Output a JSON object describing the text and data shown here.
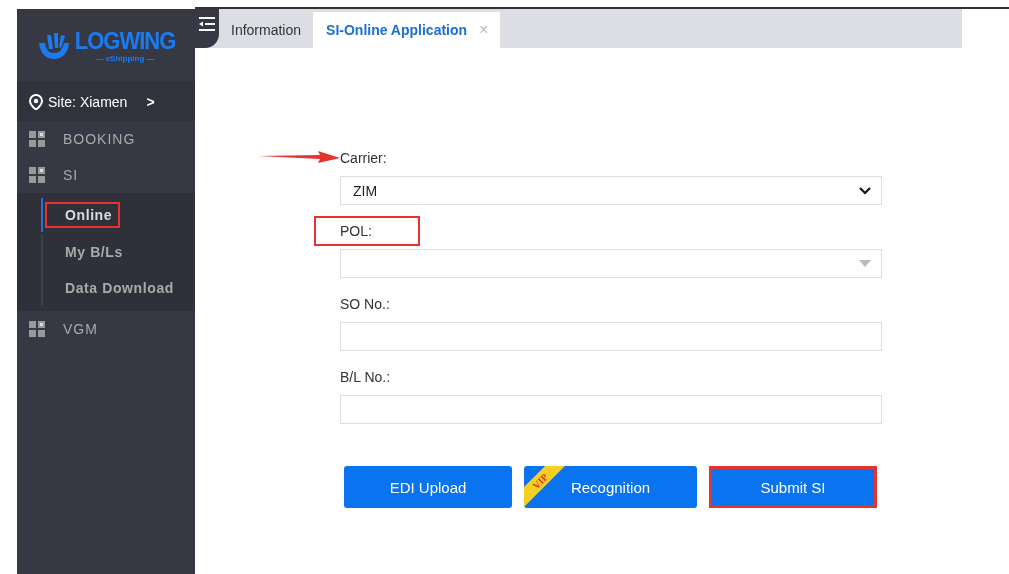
{
  "logo": {
    "name": "LOGWING",
    "tagline": "— eShipping —"
  },
  "site": {
    "label": "Site: Xiamen",
    "chevron": ">"
  },
  "nav": [
    {
      "label": "BOOKING"
    },
    {
      "label": "SI",
      "children": [
        {
          "label": "Online",
          "selected": true,
          "highlighted": true
        },
        {
          "label": "My B/Ls",
          "selected": false,
          "highlighted": false
        },
        {
          "label": "Data Download",
          "selected": false,
          "highlighted": false
        }
      ]
    },
    {
      "label": "VGM"
    }
  ],
  "tabs": [
    {
      "label": "Information",
      "selected": false
    },
    {
      "label": "SI-Online Application",
      "selected": true,
      "close": "×"
    }
  ],
  "form": {
    "fields": [
      {
        "kind": "select",
        "label": "Carrier:",
        "value": "ZIM",
        "pointed": true,
        "highlighted": false
      },
      {
        "kind": "combo",
        "label": "POL:",
        "pointed": false,
        "highlighted": true
      },
      {
        "kind": "input",
        "label": "SO No.:",
        "pointed": false,
        "highlighted": false
      },
      {
        "kind": "input",
        "label": "B/L No.:",
        "pointed": false,
        "highlighted": false
      }
    ],
    "buttons": [
      {
        "label": "EDI Upload",
        "vip": false,
        "highlighted": false
      },
      {
        "label": "Recognition",
        "vip": true,
        "vip_text": "VIP",
        "highlighted": false
      },
      {
        "label": "Submit SI",
        "vip": false,
        "highlighted": true
      }
    ]
  }
}
